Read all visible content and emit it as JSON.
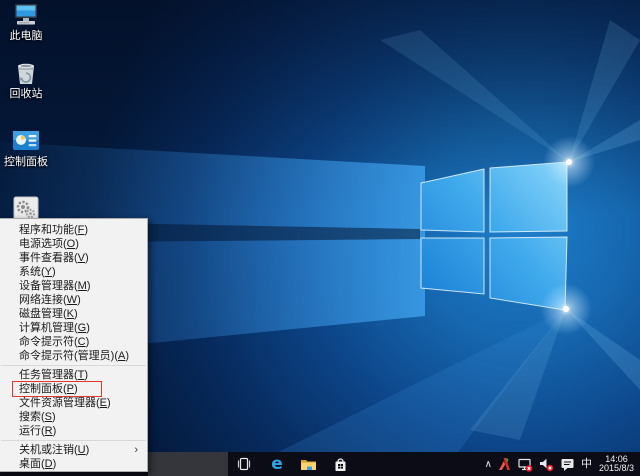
{
  "desktop": {
    "icons": [
      {
        "id": "this-pc",
        "icon": "computer-icon",
        "label": "此电脑"
      },
      {
        "id": "recycle-bin",
        "icon": "recycle-bin-icon",
        "label": "回收站"
      },
      {
        "id": "control-panel",
        "icon": "control-panel-icon",
        "label": "控制面板"
      },
      {
        "id": "gears-shortcut",
        "icon": "gears-icon",
        "label": ""
      }
    ]
  },
  "winx_menu": {
    "submenu_arrow": "›",
    "annotation_color": "#e03a2f",
    "groups": [
      {
        "items": [
          {
            "id": "programs-and-features",
            "text": "程序和功能",
            "key": "F"
          },
          {
            "id": "power-options",
            "text": "电源选项",
            "key": "O"
          },
          {
            "id": "event-viewer",
            "text": "事件查看器",
            "key": "V"
          },
          {
            "id": "system",
            "text": "系统",
            "key": "Y"
          },
          {
            "id": "device-manager",
            "text": "设备管理器",
            "key": "M"
          },
          {
            "id": "network-connections",
            "text": "网络连接",
            "key": "W"
          },
          {
            "id": "disk-management",
            "text": "磁盘管理",
            "key": "K"
          },
          {
            "id": "computer-management",
            "text": "计算机管理",
            "key": "G"
          },
          {
            "id": "command-prompt",
            "text": "命令提示符",
            "key": "C"
          },
          {
            "id": "command-prompt-admin",
            "text": "命令提示符(管理员)",
            "key": "A"
          }
        ]
      },
      {
        "items": [
          {
            "id": "task-manager",
            "text": "任务管理器",
            "key": "T"
          },
          {
            "id": "control-panel",
            "text": "控制面板",
            "key": "P",
            "highlighted": true
          },
          {
            "id": "file-explorer",
            "text": "文件资源管理器",
            "key": "E"
          },
          {
            "id": "search",
            "text": "搜索",
            "key": "S"
          },
          {
            "id": "run",
            "text": "运行",
            "key": "R"
          }
        ]
      },
      {
        "items": [
          {
            "id": "shutdown-or-signout",
            "text": "关机或注销",
            "key": "U",
            "submenu": true
          },
          {
            "id": "desktop",
            "text": "桌面",
            "key": "D"
          }
        ]
      }
    ]
  },
  "taskbar": {
    "buttons": [
      {
        "id": "task-view",
        "icon": "task-view-icon"
      },
      {
        "id": "edge",
        "icon": "edge-icon",
        "glyph": "e"
      },
      {
        "id": "file-explorer",
        "icon": "folder-icon"
      },
      {
        "id": "store",
        "icon": "store-icon"
      }
    ],
    "tray": {
      "chevron": "∧",
      "icons": [
        "tray-app-icon",
        "network-disconnected-icon",
        "volume-muted-icon",
        "action-center-icon"
      ],
      "input_indicator": "中",
      "time": "14:06",
      "date": "2015/8/3"
    }
  },
  "colors": {
    "taskbar": "#0b0c15",
    "menu_background": "#f2f2f2",
    "accent_blue": "#2aa7ea",
    "badge_red": "#e81123"
  }
}
